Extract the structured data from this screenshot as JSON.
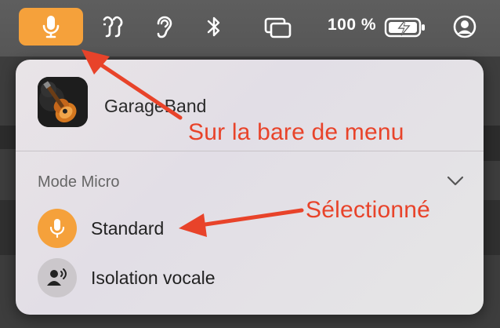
{
  "menubar": {
    "items": [
      {
        "name": "microphone-icon",
        "active": true
      },
      {
        "name": "hearing-devices-icon"
      },
      {
        "name": "ear-icon"
      },
      {
        "name": "bluetooth-icon"
      },
      {
        "name": "screen-mirroring-icon"
      },
      {
        "name": "battery-icon"
      },
      {
        "name": "user-account-icon"
      }
    ],
    "battery_percent": "100 %"
  },
  "panel": {
    "app_name": "GarageBand",
    "section_label": "Mode Micro",
    "modes": [
      {
        "label": "Standard",
        "icon": "microphone-icon",
        "selected": true
      },
      {
        "label": "Isolation vocale",
        "icon": "voice-isolation-icon",
        "selected": false
      }
    ]
  },
  "annotations": {
    "menu_note": "Sur la bare de menu",
    "selected_note": "Sélectionné"
  },
  "colors": {
    "accent": "#f5a13b",
    "annotation": "#e8432a",
    "menubar": "#5a5a5a"
  }
}
